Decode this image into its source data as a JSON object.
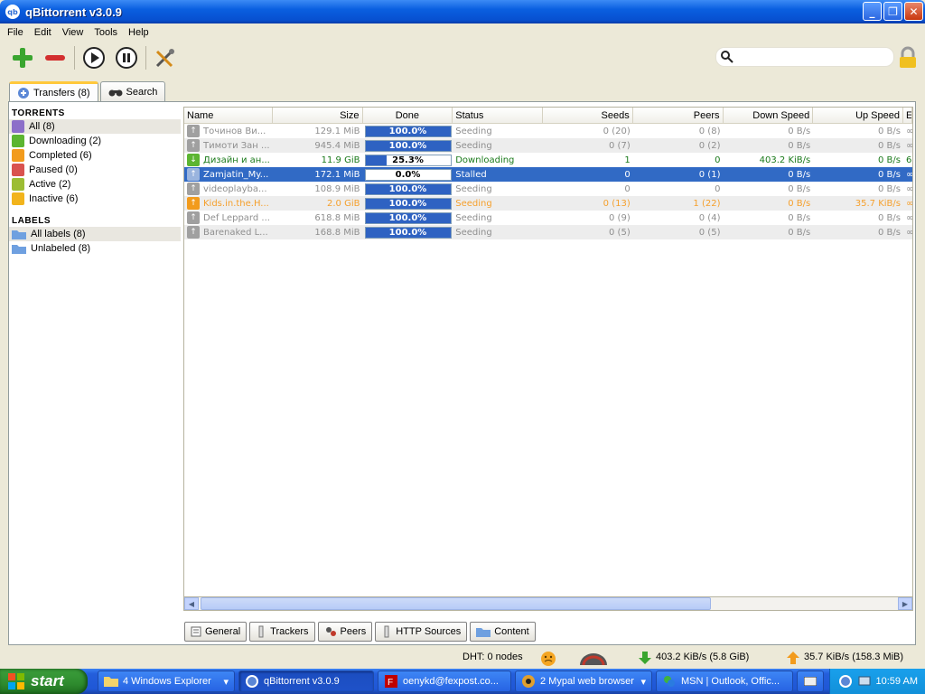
{
  "window": {
    "title": "qBittorrent v3.0.9",
    "icon_text": "qb"
  },
  "menu": [
    "File",
    "Edit",
    "View",
    "Tools",
    "Help"
  ],
  "toolbar": {
    "icons": [
      "add-torrent-icon",
      "remove-icon",
      "resume-icon",
      "pause-icon",
      "options-icon"
    ]
  },
  "search": {
    "placeholder": ""
  },
  "tabs": [
    {
      "label": "Transfers (8)"
    },
    {
      "label": "Search"
    }
  ],
  "sidebar": {
    "torrents_heading": "Torrents",
    "torrents": [
      {
        "label": "All (8)",
        "color": "#8c6fc9"
      },
      {
        "label": "Downloading (2)",
        "color": "#5cb531"
      },
      {
        "label": "Completed (6)",
        "color": "#f29b1c"
      },
      {
        "label": "Paused (0)",
        "color": "#d9534f"
      },
      {
        "label": "Active (2)",
        "color": "#9cbd34"
      },
      {
        "label": "Inactive (6)",
        "color": "#f2b41c"
      }
    ],
    "labels_heading": "Labels",
    "labels": [
      {
        "label": "All labels (8)"
      },
      {
        "label": "Unlabeled (8)"
      }
    ]
  },
  "table": {
    "columns": [
      "Name",
      "Size",
      "Done",
      "Status",
      "Seeds",
      "Peers",
      "Down Speed",
      "Up Speed",
      "E"
    ],
    "rows": [
      {
        "name": "Точинов Ви...",
        "size": "129.1 MiB",
        "done": "100.0%",
        "progress": 1.0,
        "status": "Seeding",
        "seeds": "0 (20)",
        "peers": "0 (8)",
        "down": "0 B/s",
        "up": "0 B/s",
        "extra": "∞",
        "style": "inactive"
      },
      {
        "name": "Тимоти Зан ...",
        "size": "945.4 MiB",
        "done": "100.0%",
        "progress": 1.0,
        "status": "Seeding",
        "seeds": "0 (7)",
        "peers": "0 (2)",
        "down": "0 B/s",
        "up": "0 B/s",
        "extra": "∞",
        "style": "inactive"
      },
      {
        "name": "Дизайн и ан...",
        "size": "11.9 GiB",
        "done": "25.3%",
        "progress": 0.253,
        "status": "Downloading",
        "seeds": "1",
        "peers": "0",
        "down": "403.2 KiB/s",
        "up": "0 B/s",
        "extra": "6",
        "style": "downloading"
      },
      {
        "name": "Zamjatin_My...",
        "size": "172.1 MiB",
        "done": "0.0%",
        "progress": 0.0,
        "status": "Stalled",
        "seeds": "0",
        "peers": "0 (1)",
        "down": "0 B/s",
        "up": "0 B/s",
        "extra": "∞",
        "style": "selected"
      },
      {
        "name": "videoplayba...",
        "size": "108.9 MiB",
        "done": "100.0%",
        "progress": 1.0,
        "status": "Seeding",
        "seeds": "0",
        "peers": "0",
        "down": "0 B/s",
        "up": "0 B/s",
        "extra": "∞",
        "style": "inactive"
      },
      {
        "name": "Kids.in.the.H...",
        "size": "2.0 GiB",
        "done": "100.0%",
        "progress": 1.0,
        "status": "Seeding",
        "seeds": "0 (13)",
        "peers": "1 (22)",
        "down": "0 B/s",
        "up": "35.7 KiB/s",
        "extra": "∞",
        "style": "seeding-active"
      },
      {
        "name": "Def Leppard ...",
        "size": "618.8 MiB",
        "done": "100.0%",
        "progress": 1.0,
        "status": "Seeding",
        "seeds": "0 (9)",
        "peers": "0 (4)",
        "down": "0 B/s",
        "up": "0 B/s",
        "extra": "∞",
        "style": "inactive"
      },
      {
        "name": "Barenaked L...",
        "size": "168.8 MiB",
        "done": "100.0%",
        "progress": 1.0,
        "status": "Seeding",
        "seeds": "0 (5)",
        "peers": "0 (5)",
        "down": "0 B/s",
        "up": "0 B/s",
        "extra": "∞",
        "style": "inactive"
      }
    ]
  },
  "colors": {
    "inactive": "#8f8f8f",
    "downloading": "#1a7a1a",
    "seeding_active": "#f5a02d",
    "selected_bg": "#316ac5",
    "progress": "#2e62c2"
  },
  "bottom_tabs": [
    {
      "label": "General",
      "icon": "info-icon"
    },
    {
      "label": "Trackers",
      "icon": "trackers-icon"
    },
    {
      "label": "Peers",
      "icon": "peers-icon"
    },
    {
      "label": "HTTP Sources",
      "icon": "http-sources-icon"
    },
    {
      "label": "Content",
      "icon": "folder-icon"
    }
  ],
  "status": {
    "dht": "DHT: 0 nodes",
    "download": "403.2 KiB/s (5.8 GiB)",
    "upload": "35.7 KiB/s (158.3 MiB)"
  },
  "taskbar": {
    "start": "start",
    "items": [
      {
        "label": "4 Windows Explorer",
        "icon": "folder-icon"
      },
      {
        "label": "qBittorrent v3.0.9",
        "icon": "qbittorrent-icon",
        "active": true
      },
      {
        "label": "oenykd@fexpost.co...",
        "icon": "filezilla-icon"
      },
      {
        "label": "2 Mypal web browser",
        "icon": "browser-icon"
      },
      {
        "label": "MSN | Outlook, Offic...",
        "icon": "msn-icon"
      }
    ],
    "clock": "10:59 AM"
  }
}
